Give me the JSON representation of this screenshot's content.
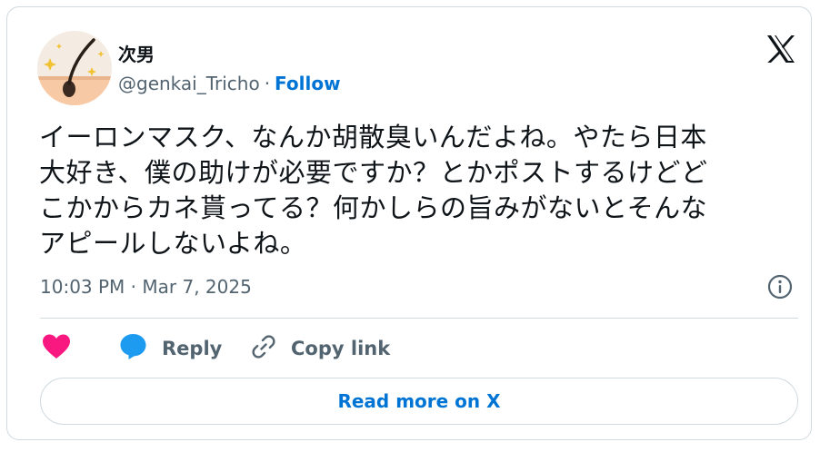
{
  "author": {
    "display_name": "次男",
    "handle": "@genkai_Tricho",
    "separator": "·",
    "follow_label": "Follow"
  },
  "tweet": {
    "lines": [
      "イーロンマスク、なんか胡散臭いんだよね。やたら日本",
      "大好き、僕の助けが必要ですか？とかポストするけどど",
      "こかからカネ貰ってる？何かしらの旨みがないとそんな",
      "アピールしないよね。"
    ],
    "timestamp": "10:03 PM · Mar 7, 2025"
  },
  "actions": {
    "like_icon": "heart-icon",
    "reply_label": "Reply",
    "reply_icon": "speech-bubble-icon",
    "copy_label": "Copy link",
    "copy_icon": "link-icon"
  },
  "read_more_label": "Read more on X",
  "icons": {
    "brand": "x-logo-icon",
    "info": "info-icon"
  },
  "colors": {
    "accent": "#0074d4",
    "like": "#f91880",
    "reply": "#1d9bf0",
    "muted_text": "#536471",
    "border": "#cfd9de",
    "avatar_bg": "#f4ebe2",
    "avatar_skin": "#f7c9a4"
  }
}
